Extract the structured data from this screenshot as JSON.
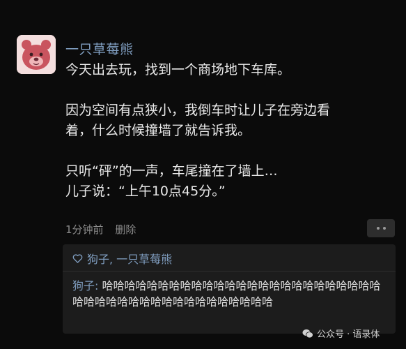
{
  "post": {
    "author": "一只草莓熊",
    "lines": [
      "今天出去玩，找到一个商场地下车库。",
      "因为空间有点狭小，我倒车时让儿子在旁边看",
      "着，什么时候撞墙了就告诉我。",
      "只听“砰”的一声，车尾撞在了墙上…",
      "儿子说：“上午10点45分。”"
    ],
    "time": "1分钟前",
    "delete_label": "删除"
  },
  "interactions": {
    "likes": "狗子, 一只草莓熊",
    "comment": {
      "author": "狗子:",
      "text": " 哈哈哈哈哈哈哈哈哈哈哈哈哈哈哈哈哈哈哈哈哈哈哈哈哈哈哈哈哈哈哈哈哈哈哈哈哈哈哈哈哈哈哈"
    }
  },
  "watermark": {
    "text": "公众号 · 语录体"
  },
  "colors": {
    "background": "#0b0b0b",
    "name_blue": "#7f9dbf",
    "panel": "#1c1c1c"
  },
  "icons": {
    "avatar": "strawberry-bear-avatar",
    "like": "heart-icon",
    "more": "more-dots-icon",
    "watermark": "wechat-icon"
  }
}
